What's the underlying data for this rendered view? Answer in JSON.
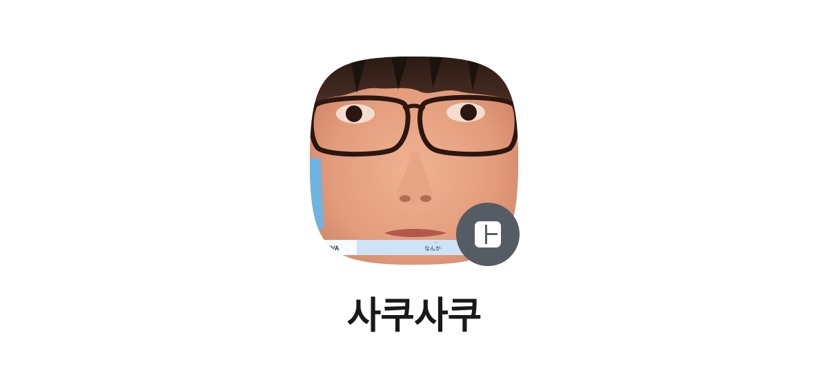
{
  "profile": {
    "name": "사쿠사쿠",
    "avatar_icon": "profile-photo",
    "badge_icon": "layout-widget-icon",
    "badge_color": "#565c63",
    "caption": {
      "left": "IVA",
      "center_top": "…",
      "center": "なんか"
    }
  }
}
